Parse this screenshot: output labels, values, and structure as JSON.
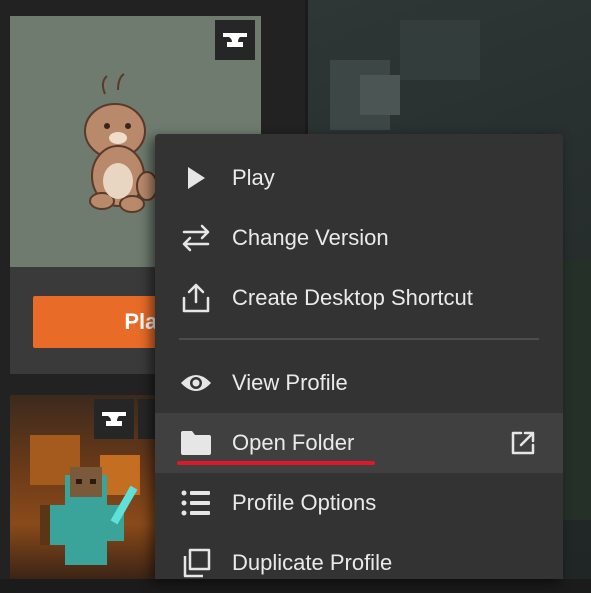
{
  "instance_cards": [
    {
      "play_label": "Play",
      "loader": "anvil-icon"
    },
    {
      "loader": "anvil-icon"
    }
  ],
  "context_menu": {
    "items": [
      {
        "label": "Play",
        "icon": "play-icon"
      },
      {
        "label": "Change Version",
        "icon": "swap-arrows-icon"
      },
      {
        "label": "Create Desktop Shortcut",
        "icon": "share-upload-icon"
      },
      {
        "label": "View Profile",
        "icon": "eye-icon"
      },
      {
        "label": "Open Folder",
        "icon": "folder-icon",
        "trailing_icon": "external-link-icon"
      },
      {
        "label": "Profile Options",
        "icon": "list-icon"
      },
      {
        "label": "Duplicate Profile",
        "icon": "duplicate-icon"
      }
    ]
  },
  "colors": {
    "accent": "#e86b28",
    "menu_bg": "#333333",
    "hover_bg": "#404040",
    "underline": "#e0162b"
  }
}
